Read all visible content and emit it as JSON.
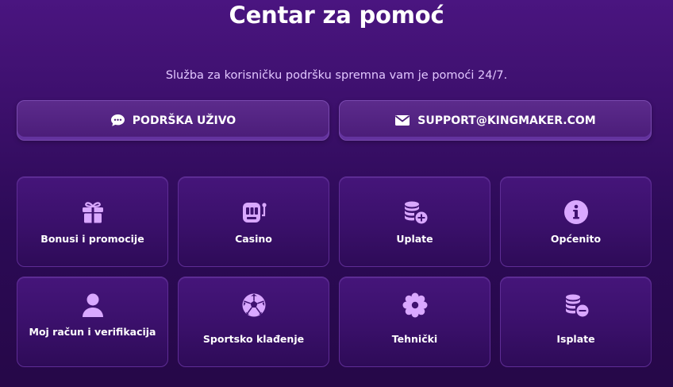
{
  "header": {
    "title": "Centar za pomoć",
    "subtitle": "Služba za korisničku podršku spremna vam je pomoći 24/7."
  },
  "contact": {
    "live_label": "PODRŠKA UŽIVO",
    "live_icon": "chat-bubble-icon",
    "email_label": "SUPPORT@KINGMAKER.COM",
    "email_icon": "envelope-icon"
  },
  "categories": [
    {
      "label": "Bonusi i promocije",
      "icon": "gift-icon"
    },
    {
      "label": "Casino",
      "icon": "slot-machine-icon"
    },
    {
      "label": "Uplate",
      "icon": "coins-plus-icon"
    },
    {
      "label": "Općenito",
      "icon": "info-icon"
    },
    {
      "label": "Moj račun i verifikacija",
      "icon": "user-icon"
    },
    {
      "label": "Sportsko klađenje",
      "icon": "soccer-ball-icon"
    },
    {
      "label": "Tehnički",
      "icon": "gear-icon"
    },
    {
      "label": "Isplate",
      "icon": "coins-minus-icon"
    }
  ],
  "colors": {
    "icon": "#d9a8ff",
    "background": "#3b0f6a",
    "subtitle": "#e2c7ff"
  }
}
